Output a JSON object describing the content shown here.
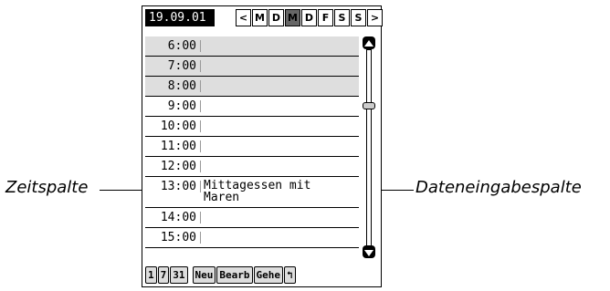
{
  "header": {
    "date": "19.09.01",
    "prev_label": "<",
    "next_label": ">",
    "days": [
      {
        "label": "M",
        "selected": false
      },
      {
        "label": "D",
        "selected": false
      },
      {
        "label": "M",
        "selected": true
      },
      {
        "label": "D",
        "selected": false
      },
      {
        "label": "F",
        "selected": false
      },
      {
        "label": "S",
        "selected": false
      },
      {
        "label": "S",
        "selected": false
      }
    ]
  },
  "schedule": {
    "rows": [
      {
        "time": "6:00",
        "entry": ""
      },
      {
        "time": "7:00",
        "entry": ""
      },
      {
        "time": "8:00",
        "entry": ""
      },
      {
        "time": "9:00",
        "entry": ""
      },
      {
        "time": "10:00",
        "entry": ""
      },
      {
        "time": "11:00",
        "entry": ""
      },
      {
        "time": "12:00",
        "entry": ""
      },
      {
        "time": "13:00",
        "entry": "Mittagessen mit\nMaren"
      },
      {
        "time": "14:00",
        "entry": ""
      },
      {
        "time": "15:00",
        "entry": ""
      }
    ]
  },
  "toolbar": {
    "view_1": "1",
    "view_7": "7",
    "view_31": "31",
    "new_label": "Neu",
    "edit_label": "Bearb",
    "goto_label": "Gehe",
    "menu_label": "↰"
  },
  "callouts": {
    "left": "Zeitspalte",
    "right": "Dateneingabespalte"
  }
}
